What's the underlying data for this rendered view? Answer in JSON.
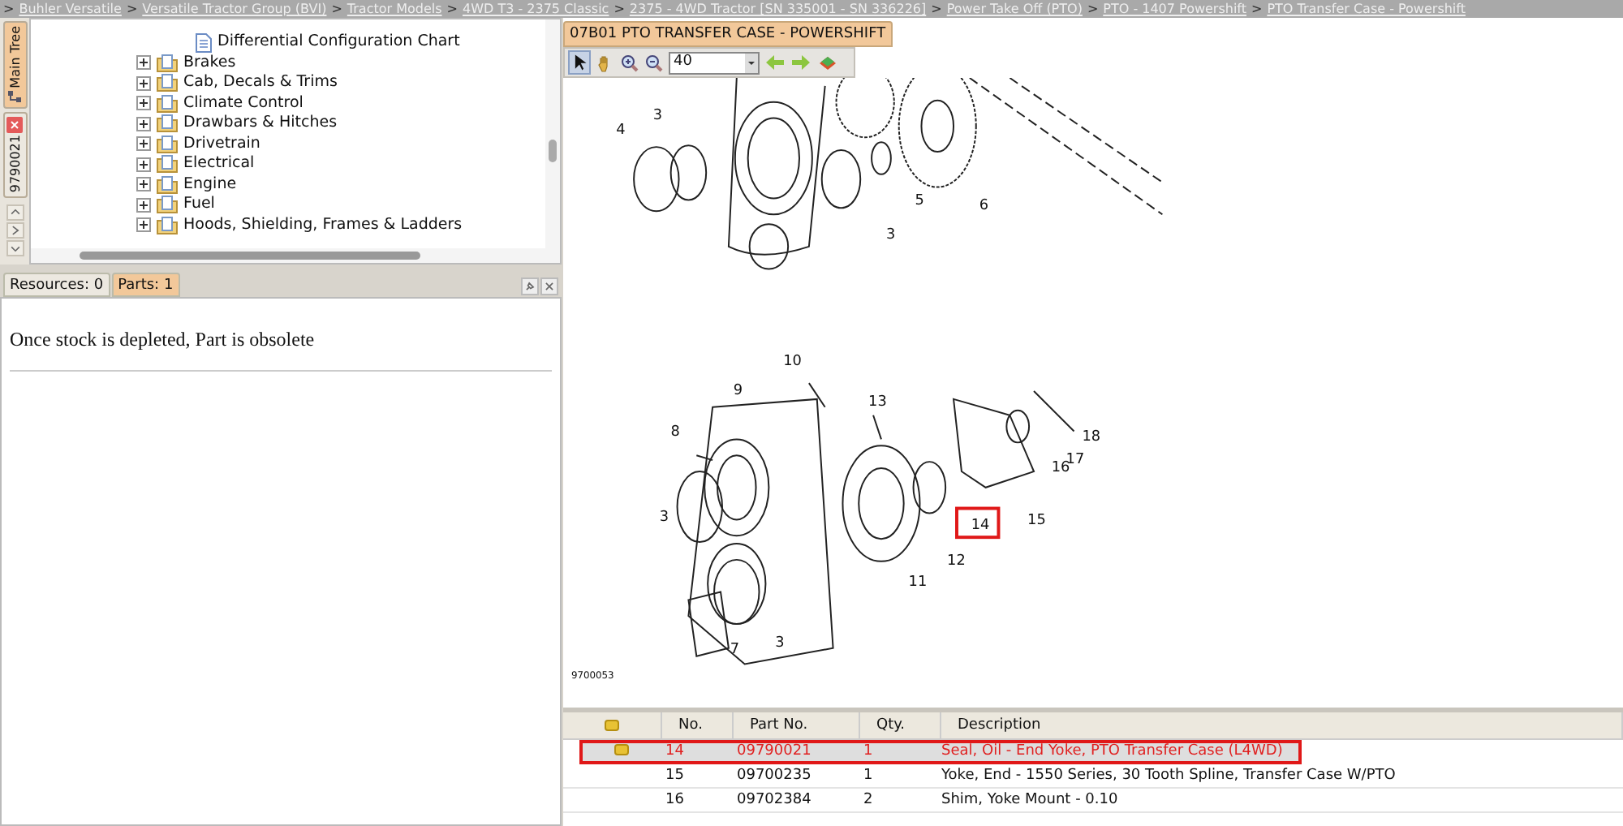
{
  "breadcrumb": {
    "separator": ">",
    "items": [
      "Buhler Versatile",
      "Versatile Tractor Group (BVI)",
      "Tractor Models",
      "4WD T3 - 2375 Classic",
      "2375 - 4WD Tractor [SN 335001 - SN 336226]",
      "Power Take Off (PTO)",
      "PTO - 1407 Powershift",
      "PTO Transfer Case - Powershift"
    ]
  },
  "side_tabs": [
    {
      "label": "Main Tree",
      "selected": true,
      "kind": "tree"
    },
    {
      "label": "9790021",
      "selected": false,
      "kind": "closable"
    }
  ],
  "tree": {
    "items": [
      {
        "kind": "document",
        "label": "Differential Configuration Chart"
      },
      {
        "kind": "folder",
        "label": "Brakes",
        "expanded": false
      },
      {
        "kind": "folder",
        "label": "Cab, Decals & Trims",
        "expanded": false
      },
      {
        "kind": "folder",
        "label": "Climate Control",
        "expanded": false
      },
      {
        "kind": "folder",
        "label": "Drawbars & Hitches",
        "expanded": false
      },
      {
        "kind": "folder",
        "label": "Drivetrain",
        "expanded": false
      },
      {
        "kind": "folder",
        "label": "Electrical",
        "expanded": false
      },
      {
        "kind": "folder",
        "label": "Engine",
        "expanded": false
      },
      {
        "kind": "folder",
        "label": "Fuel",
        "expanded": false
      },
      {
        "kind": "folder",
        "label": "Hoods, Shielding, Frames & Ladders",
        "expanded": false
      }
    ]
  },
  "info_tabs": [
    {
      "label": "Resources: 0",
      "selected": false
    },
    {
      "label": "Parts: 1",
      "selected": true
    }
  ],
  "info_text": "Once stock is depleted, Part is obsolete",
  "diagram": {
    "title": "07B01 PTO TRANSFER CASE - POWERSHIFT",
    "zoom": "40",
    "figure_id": "9700053",
    "callouts": [
      {
        "label": "4",
        "selected": false
      },
      {
        "label": "3",
        "selected": false
      },
      {
        "label": "5",
        "selected": false
      },
      {
        "label": "6",
        "selected": false
      },
      {
        "label": "3",
        "selected": false
      },
      {
        "label": "10",
        "selected": false
      },
      {
        "label": "9",
        "selected": false
      },
      {
        "label": "13",
        "selected": false
      },
      {
        "label": "8",
        "selected": false
      },
      {
        "label": "18",
        "selected": false
      },
      {
        "label": "17",
        "selected": false
      },
      {
        "label": "16",
        "selected": false
      },
      {
        "label": "3",
        "selected": false
      },
      {
        "label": "14",
        "selected": true
      },
      {
        "label": "15",
        "selected": false
      },
      {
        "label": "12",
        "selected": false
      },
      {
        "label": "11",
        "selected": false
      },
      {
        "label": "7",
        "selected": false
      },
      {
        "label": "3",
        "selected": false
      }
    ]
  },
  "table": {
    "columns": [
      "No.",
      "Part No.",
      "Qty.",
      "Description"
    ],
    "rows": [
      {
        "no": "14",
        "part_no": "09790021",
        "qty": "1",
        "description": "Seal, Oil - End Yoke, PTO Transfer Case (L4WD)",
        "selected": true,
        "flag": true
      },
      {
        "no": "15",
        "part_no": "09700235",
        "qty": "1",
        "description": "Yoke, End - 1550 Series, 30 Tooth Spline, Transfer Case W/PTO",
        "selected": false,
        "flag": false
      },
      {
        "no": "16",
        "part_no": "09702384",
        "qty": "2",
        "description": "Shim, Yoke Mount - 0.10",
        "selected": false,
        "flag": false
      }
    ]
  }
}
